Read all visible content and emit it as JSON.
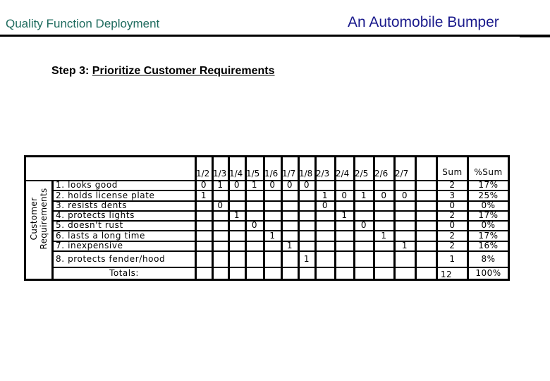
{
  "header": {
    "left_title": "Quality Function Deployment",
    "right_title": "An Automobile Bumper"
  },
  "step": {
    "prefix": "Step 3: ",
    "title": "Prioritize Customer Requirements"
  },
  "table": {
    "row_group_label": "Customer Requirements",
    "columns": [
      "1/2",
      "1/3",
      "1/4",
      "1/5",
      "1/6",
      "1/7",
      "1/8",
      "2/3",
      "2/4",
      "2/5",
      "2/6",
      "2/7",
      ""
    ],
    "sum_header": "Sum",
    "pct_header": "%Sum",
    "rows": [
      {
        "label": "1. looks good",
        "cells": [
          "0",
          "1",
          "0",
          "1",
          "0",
          "0",
          "0",
          "",
          "",
          "",
          "",
          "",
          ""
        ],
        "sum": "2",
        "pct": "17%"
      },
      {
        "label": "2. holds license plate",
        "cells": [
          "1",
          "",
          "",
          "",
          "",
          "",
          "",
          "1",
          "0",
          "1",
          "0",
          "0",
          ""
        ],
        "sum": "3",
        "pct": "25%"
      },
      {
        "label": "3. resists dents",
        "cells": [
          "",
          "0",
          "",
          "",
          "",
          "",
          "",
          "0",
          "",
          "",
          "",
          "",
          ""
        ],
        "sum": "0",
        "pct": "0%"
      },
      {
        "label": "4. protects lights",
        "cells": [
          "",
          "",
          "1",
          "",
          "",
          "",
          "",
          "",
          "1",
          "",
          "",
          "",
          ""
        ],
        "sum": "2",
        "pct": "17%"
      },
      {
        "label": "5. doesn't rust",
        "cells": [
          "",
          "",
          "",
          "0",
          "",
          "",
          "",
          "",
          "",
          "0",
          "",
          "",
          ""
        ],
        "sum": "0",
        "pct": "0%"
      },
      {
        "label": "6. lasts a long time",
        "cells": [
          "",
          "",
          "",
          "",
          "1",
          "",
          "",
          "",
          "",
          "",
          "1",
          "",
          ""
        ],
        "sum": "2",
        "pct": "17%"
      },
      {
        "label": "7. inexpensive",
        "cells": [
          "",
          "",
          "",
          "",
          "",
          "1",
          "",
          "",
          "",
          "",
          "",
          "1",
          ""
        ],
        "sum": "2",
        "pct": "16%"
      },
      {
        "label": "8. protects fender/hood",
        "cells": [
          "",
          "",
          "",
          "",
          "",
          "",
          "1",
          "",
          "",
          "",
          "",
          "",
          ""
        ],
        "sum": "1",
        "pct": "8%"
      }
    ],
    "totals_label": "Totals:",
    "totals_sum": "12",
    "totals_pct": "100%"
  }
}
